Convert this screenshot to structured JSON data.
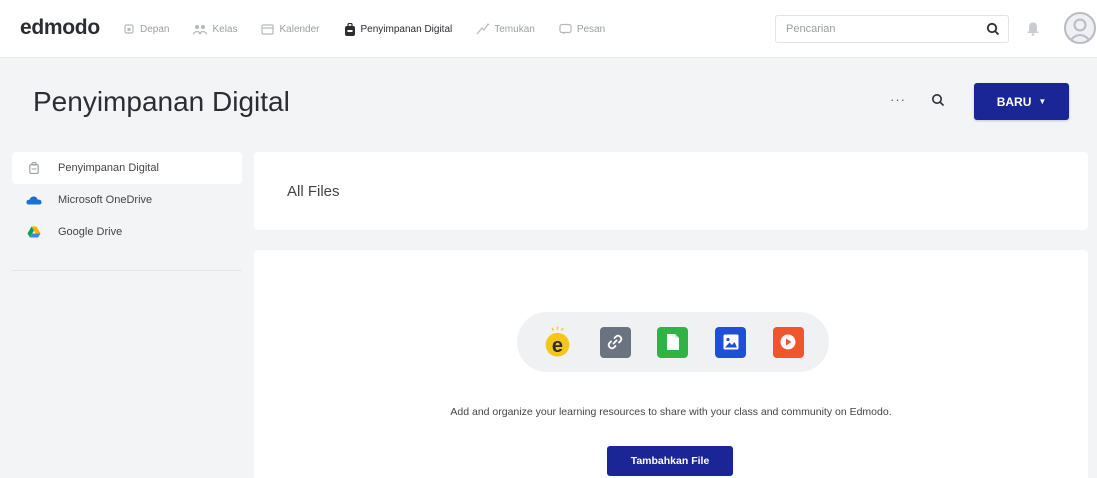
{
  "app": {
    "logo": "edmodo"
  },
  "nav": {
    "items": [
      {
        "label": "Depan",
        "icon": "home-icon",
        "active": false
      },
      {
        "label": "Kelas",
        "icon": "classes-icon",
        "active": false
      },
      {
        "label": "Kalender",
        "icon": "calendar-icon",
        "active": false
      },
      {
        "label": "Penyimpanan Digital",
        "icon": "backpack-icon",
        "active": true
      },
      {
        "label": "Temukan",
        "icon": "discover-icon",
        "active": false
      },
      {
        "label": "Pesan",
        "icon": "message-icon",
        "active": false
      }
    ],
    "search_placeholder": "Pencarian"
  },
  "header": {
    "title": "Penyimpanan Digital",
    "more_label": "···",
    "new_button": "BARU"
  },
  "sidebar": {
    "items": [
      {
        "label": "Penyimpanan Digital",
        "icon": "backpack-icon",
        "active": true
      },
      {
        "label": "Microsoft OneDrive",
        "icon": "onedrive-icon",
        "active": false
      },
      {
        "label": "Google Drive",
        "icon": "google-drive-icon",
        "active": false
      }
    ]
  },
  "main": {
    "section_title": "All Files",
    "empty_state": {
      "icons": [
        "edmodo-icon",
        "link-icon",
        "document-icon",
        "image-icon",
        "video-icon"
      ],
      "message": "Add and organize your learning resources to share with your class and community on Edmodo.",
      "add_button": "Tambahkan File"
    }
  },
  "colors": {
    "primary": "#1a2596",
    "edmodo_yellow": "#f5c518",
    "link_gray": "#6b7280",
    "doc_green": "#2fb344",
    "image_blue": "#1f4fd6",
    "video_orange": "#f0552b"
  }
}
